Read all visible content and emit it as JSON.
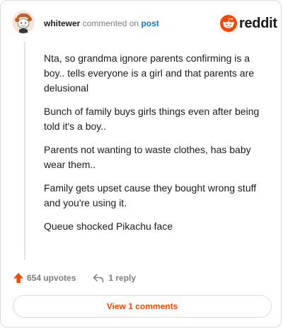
{
  "header": {
    "username": "whitewer",
    "action_text": "commented on",
    "post_link": "post",
    "brand": "reddit"
  },
  "comment": {
    "paragraphs": [
      "Nta, so grandma ignore parents confirming is a boy.. tells everyone is a girl and that parents are delusional",
      "Bunch of family buys girls things even after being told it's a boy..",
      "Parents not wanting to waste clothes, has baby wear them..",
      "Family gets upset cause they bought wrong stuff and you're using it.",
      "Queue shocked Pikachu face"
    ]
  },
  "actions": {
    "upvotes": "654 upvotes",
    "replies": "1 reply"
  },
  "footer": {
    "view_comments": "View 1 comments"
  },
  "colors": {
    "brand_orange": "#ff4500",
    "link_blue": "#0079d3",
    "muted_gray": "#7c7c7c"
  },
  "icons": {
    "avatar": "snoo-avatar-icon",
    "logo": "reddit-logo-icon",
    "upvote": "upvote-arrow-icon",
    "reply": "reply-arrow-icon"
  }
}
